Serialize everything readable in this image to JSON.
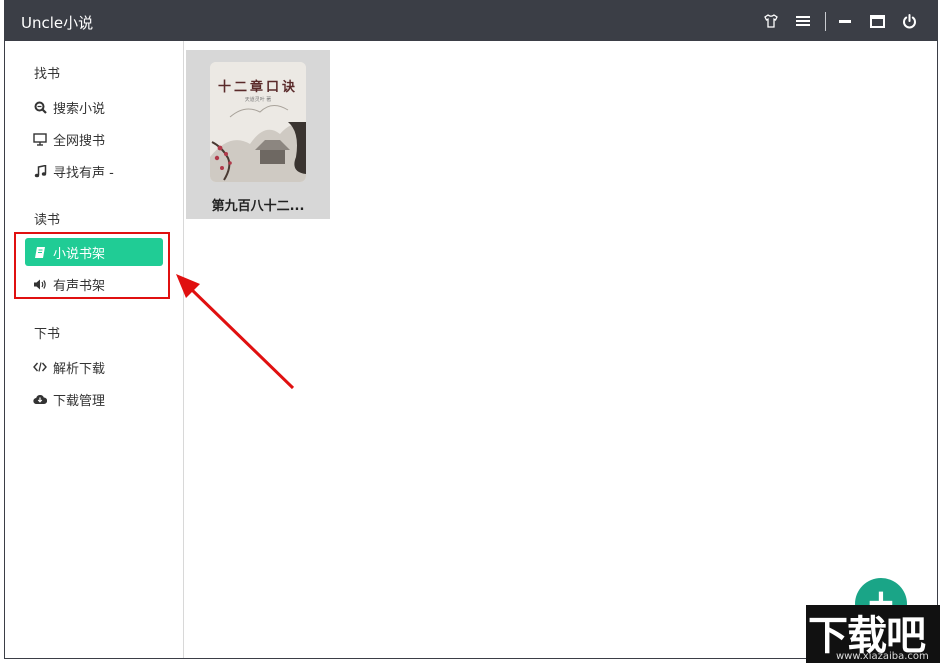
{
  "window": {
    "title": "Uncle小说",
    "controls": [
      "shirt-icon",
      "menu-icon",
      "minimize-icon",
      "maximize-icon",
      "power-icon"
    ]
  },
  "sidebar": {
    "sections": [
      {
        "title": "找书",
        "items": [
          {
            "label": "搜索小说",
            "icon": "search-icon"
          },
          {
            "label": "全网搜书",
            "icon": "monitor-icon"
          },
          {
            "label": "寻找有声 -",
            "icon": "music-icon"
          }
        ]
      },
      {
        "title": "读书",
        "items": [
          {
            "label": "小说书架",
            "icon": "book-icon",
            "active": true
          },
          {
            "label": "有声书架",
            "icon": "volume-icon"
          }
        ]
      },
      {
        "title": "下书",
        "items": [
          {
            "label": "解析下载",
            "icon": "code-icon"
          },
          {
            "label": "下载管理",
            "icon": "cloud-download-icon"
          }
        ]
      }
    ]
  },
  "bookshelf": {
    "books": [
      {
        "name": "第九百八十二...",
        "cover_title": "十二章口诀",
        "cover_author": "天道灵叶 著"
      }
    ]
  },
  "fab": {
    "icon": "plus-icon"
  },
  "watermark": {
    "big": "下载吧",
    "small": "www.xiazaiba.com"
  },
  "colors": {
    "titlebar": "#3b3e46",
    "accent": "#20cc95",
    "highlight": "#e01010"
  }
}
